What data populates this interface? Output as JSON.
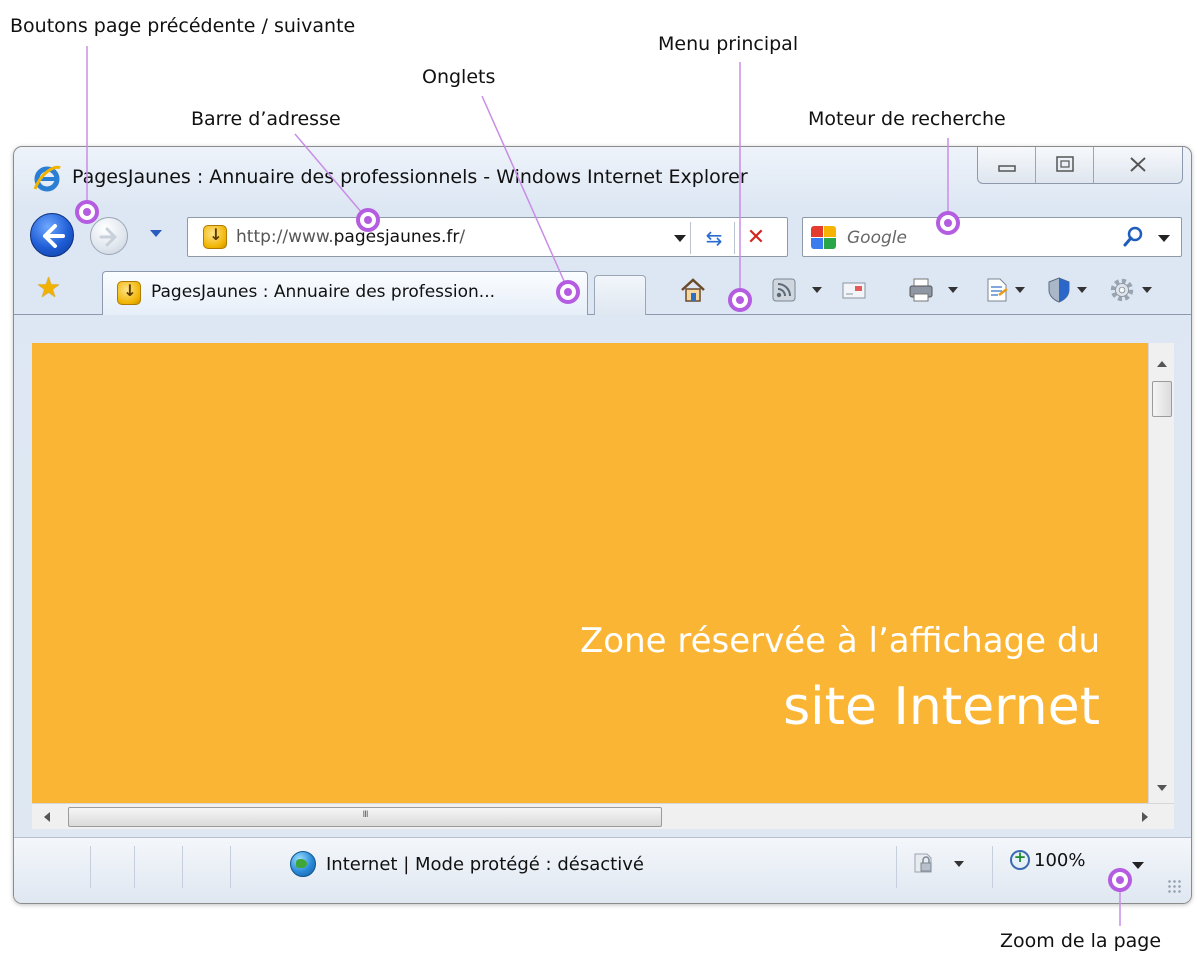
{
  "annotations": {
    "nav_buttons": "Boutons page précédente / suivante",
    "main_menu": "Menu principal",
    "tabs": "Onglets",
    "address_bar": "Barre d’adresse",
    "search_engine": "Moteur de recherche",
    "page_zoom": "Zoom de la page"
  },
  "window": {
    "title": "PagesJaunes : Annuaire des professionnels - Windows Internet Explorer"
  },
  "address": {
    "prefix": "http://www.",
    "domain": "pagesjaunes.fr",
    "suffix": "/"
  },
  "search": {
    "placeholder": "Google"
  },
  "tab": {
    "title": "PagesJaunes : Annuaire des profession..."
  },
  "content": {
    "line1": "Zone réservée à l’affichage du",
    "line2": "site Internet",
    "background": "#fbb534"
  },
  "status": {
    "zone_text": "Internet | Mode protégé : désactivé",
    "zoom": "100%"
  },
  "colors": {
    "annotation_marker": "#b45de0",
    "annotation_line": "#c88ee6"
  },
  "icons": [
    "ie-logo-icon",
    "back-arrow-icon",
    "forward-arrow-icon",
    "security-site-icon",
    "refresh-icon",
    "stop-icon",
    "google-icon",
    "search-icon",
    "favorites-star-icon",
    "home-icon",
    "rss-feed-icon",
    "mail-icon",
    "print-icon",
    "page-icon",
    "safety-icon",
    "tools-gear-icon",
    "globe-icon",
    "protected-mode-icon",
    "zoom-icon"
  ]
}
